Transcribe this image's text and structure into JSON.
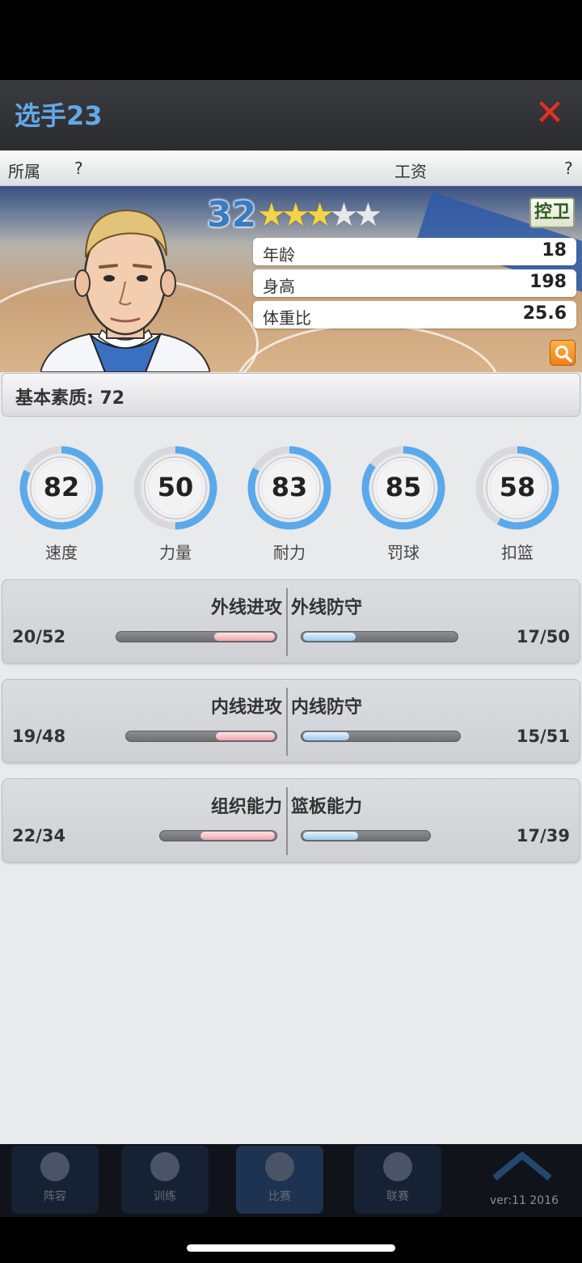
{
  "window": {
    "title": "选手23"
  },
  "info_row": {
    "team_label": "所属",
    "team_value": "?",
    "salary_label": "工资",
    "salary_value": "?"
  },
  "player": {
    "overall": "32",
    "stars": {
      "filled": 3,
      "total": 5
    },
    "position": "控卫",
    "attributes": [
      {
        "label": "年龄",
        "value": "18"
      },
      {
        "label": "身高",
        "value": "198"
      },
      {
        "label": "体重比",
        "value": "25.6"
      }
    ]
  },
  "quality": {
    "text": "基本素质: 72"
  },
  "gauges": [
    {
      "name": "速度",
      "value": 82
    },
    {
      "name": "力量",
      "value": 50
    },
    {
      "name": "耐力",
      "value": 83
    },
    {
      "name": "罚球",
      "value": 85
    },
    {
      "name": "扣篮",
      "value": 58
    }
  ],
  "comparisons": [
    {
      "left_title": "外线进攻",
      "left_value": "20/52",
      "left_ratio": 0.385,
      "right_title": "外线防守",
      "right_value": "17/50",
      "right_ratio": 0.34
    },
    {
      "left_title": "内线进攻",
      "left_value": "19/48",
      "left_ratio": 0.396,
      "right_title": "内线防守",
      "right_value": "15/51",
      "right_ratio": 0.294
    },
    {
      "left_title": "组织能力",
      "left_value": "22/34",
      "left_ratio": 0.647,
      "right_title": "篮板能力",
      "right_value": "17/39",
      "right_ratio": 0.436
    }
  ],
  "tabs": [
    {
      "label": "阵容"
    },
    {
      "label": "训练"
    },
    {
      "label": "比赛"
    },
    {
      "label": "联赛"
    },
    {
      "label": ""
    }
  ],
  "footer": {
    "version": "ver:11  2016"
  },
  "colors": {
    "accent": "#63a9e6",
    "gauge_fill": "#5aa9ea",
    "gauge_track": "#d9d9dc",
    "close": "#d9352a"
  }
}
